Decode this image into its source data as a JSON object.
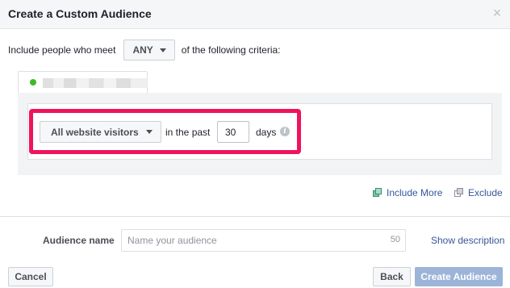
{
  "dialog": {
    "title": "Create a Custom Audience",
    "close_glyph": "×"
  },
  "criteria": {
    "prefix": "Include people who meet",
    "match_value": "ANY",
    "suffix": "of the following criteria:"
  },
  "rule": {
    "visitor_type": "All website visitors",
    "in_the_past": "in the past",
    "days_value": "30",
    "days_label": "days",
    "info_glyph": "i",
    "highlight_color": "#f0135c"
  },
  "actions": {
    "include_more": "Include More",
    "exclude": "Exclude"
  },
  "audience": {
    "label": "Audience name",
    "placeholder": "Name your audience",
    "char_limit": "50",
    "show_description": "Show description"
  },
  "footer": {
    "cancel": "Cancel",
    "back": "Back",
    "create": "Create Audience"
  },
  "colors": {
    "link": "#365899",
    "primary_disabled": "#9cb4d8",
    "status_dot": "#42b72a"
  },
  "icons": {
    "close": "close-icon",
    "caret": "caret-down-icon",
    "info": "info-icon",
    "include": "include-squares-icon",
    "exclude": "exclude-squares-icon",
    "status": "status-dot-icon"
  }
}
